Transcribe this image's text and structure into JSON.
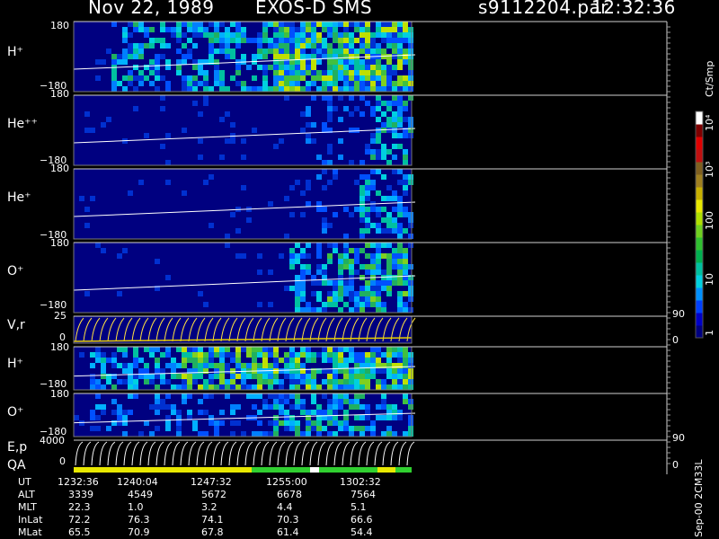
{
  "header": {
    "date": "Nov 22, 1989",
    "mission": "EXOS-D SMS",
    "file": "s9112204.par",
    "time": "12:32:36"
  },
  "colorbar": {
    "unit": "Ct/Smp",
    "tick_labels": [
      "1",
      "10",
      "100",
      "10³",
      "10⁴"
    ],
    "colors": [
      "#000080",
      "#0000c8",
      "#0040ff",
      "#0090ff",
      "#00d0e0",
      "#00c0a0",
      "#00b050",
      "#30c030",
      "#70d020",
      "#b0e000",
      "#e8e800",
      "#c8b000",
      "#a08020",
      "#806020",
      "#c01010",
      "#e00000",
      "#800000",
      "#ffffff"
    ]
  },
  "panels": [
    {
      "id": "hplus",
      "label": "H⁺",
      "top_tick": "180",
      "bottom_tick": "−180",
      "right": ""
    },
    {
      "id": "heplusplus",
      "label": "He⁺⁺",
      "top_tick": "180",
      "bottom_tick": "−180",
      "right": ""
    },
    {
      "id": "heplus",
      "label": "He⁺",
      "top_tick": "180",
      "bottom_tick": "−180",
      "right": ""
    },
    {
      "id": "oplus",
      "label": "O⁺",
      "top_tick": "180",
      "bottom_tick": "−180",
      "right": ""
    },
    {
      "id": "vr",
      "label": "V,r",
      "top_tick": "25",
      "bottom_tick": "0",
      "right_top": "90",
      "right_bottom": "0"
    },
    {
      "id": "hplus2",
      "label": "H⁺",
      "top_tick": "180",
      "bottom_tick": "−180",
      "right": ""
    },
    {
      "id": "oplus2",
      "label": "O⁺",
      "top_tick": "180",
      "bottom_tick": "−180",
      "right": ""
    },
    {
      "id": "ep",
      "label": "E,p",
      "label2": "QA",
      "top_tick": "4000",
      "bottom_tick": "0",
      "right_top": "90",
      "right_bottom": "0"
    }
  ],
  "footer": {
    "rows": [
      {
        "name": "UT",
        "values": [
          "1232:36",
          "1240:04",
          "1247:32",
          "1255:00",
          "1302:32"
        ]
      },
      {
        "name": "ALT",
        "values": [
          "3339",
          "4549",
          "5672",
          "6678",
          "7564"
        ]
      },
      {
        "name": "MLT",
        "values": [
          "22.3",
          "1.0",
          "3.2",
          "4.4",
          "5.1"
        ]
      },
      {
        "name": "InLat",
        "values": [
          "72.2",
          "76.3",
          "74.1",
          "70.3",
          "66.6"
        ]
      },
      {
        "name": "MLat",
        "values": [
          "65.5",
          "70.9",
          "67.8",
          "61.4",
          "54.4"
        ]
      }
    ],
    "version": "Sep-00 2CM33L"
  },
  "chart_data": {
    "type": "heatmap",
    "title": "Nov 22, 1989   EXOS-D SMS",
    "x_axis": {
      "ticks": [
        "1232:36",
        "1240:04",
        "1247:32",
        "1255:00",
        "1302:32"
      ]
    },
    "colorscale": {
      "unit": "Ct/Smp",
      "scale": "log",
      "range": [
        1,
        10000
      ]
    },
    "series": [
      {
        "name": "H⁺",
        "ylim": [
          -180,
          180
        ]
      },
      {
        "name": "He⁺⁺",
        "ylim": [
          -180,
          180
        ]
      },
      {
        "name": "He⁺",
        "ylim": [
          -180,
          180
        ]
      },
      {
        "name": "O⁺",
        "ylim": [
          -180,
          180
        ]
      },
      {
        "name": "V,r",
        "ylim": [
          0,
          25
        ]
      },
      {
        "name": "H⁺",
        "ylim": [
          -180,
          180
        ]
      },
      {
        "name": "O⁺",
        "ylim": [
          -180,
          180
        ]
      },
      {
        "name": "E,p",
        "ylim": [
          0,
          4000
        ]
      }
    ]
  }
}
